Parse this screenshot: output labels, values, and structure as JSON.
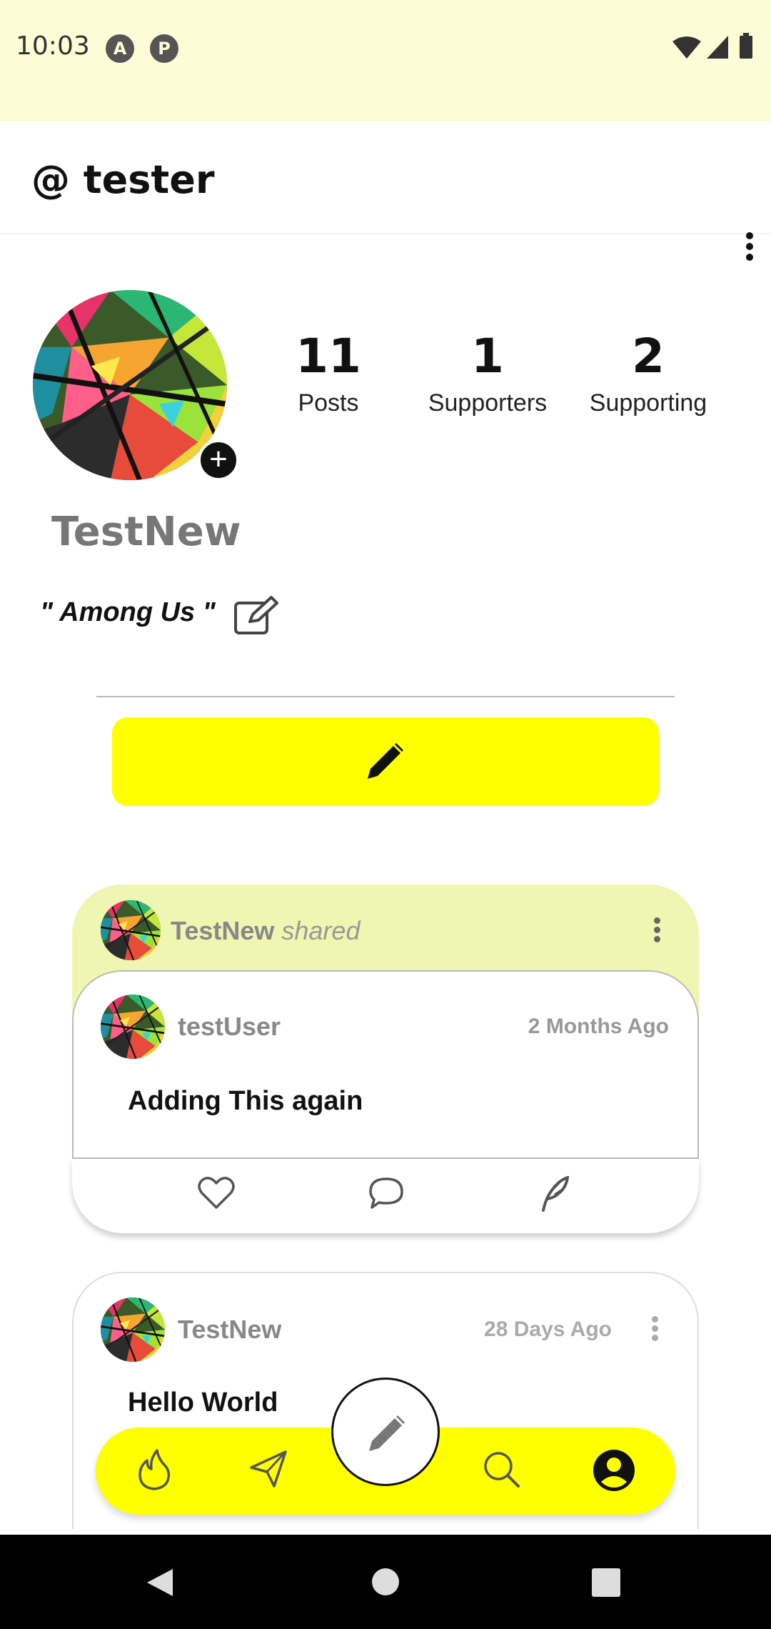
{
  "status": {
    "time": "10:03",
    "app_icons": [
      "A",
      "P"
    ]
  },
  "header": {
    "handle": "@ tester"
  },
  "profile": {
    "stats": [
      {
        "value": "11",
        "label": "Posts"
      },
      {
        "value": "1",
        "label": "Supporters"
      },
      {
        "value": "2",
        "label": "Supporting"
      }
    ],
    "display_name": "TestNew",
    "bio": "\" Among  Us \""
  },
  "feed": {
    "shared_post": {
      "sharer": "TestNew",
      "shared_word": "shared",
      "author": "testUser",
      "time": "2 Months Ago",
      "text": "Adding This again"
    },
    "post": {
      "author": "TestNew",
      "time": "28 Days Ago",
      "text": "Hello World"
    }
  },
  "icons": {
    "more": "more-vert-icon",
    "add": "plus-icon",
    "edit_bio": "edit-square-icon",
    "compose": "pencil-icon",
    "like": "heart-icon",
    "comment": "comment-bubble-icon",
    "share": "feather-icon",
    "nav": [
      "flame-icon",
      "send-icon",
      "search-icon",
      "profile-icon"
    ]
  },
  "colors": {
    "accent": "#ffff00",
    "status_bar": "#fefcd7",
    "shared_bg": "#eef6b2"
  }
}
